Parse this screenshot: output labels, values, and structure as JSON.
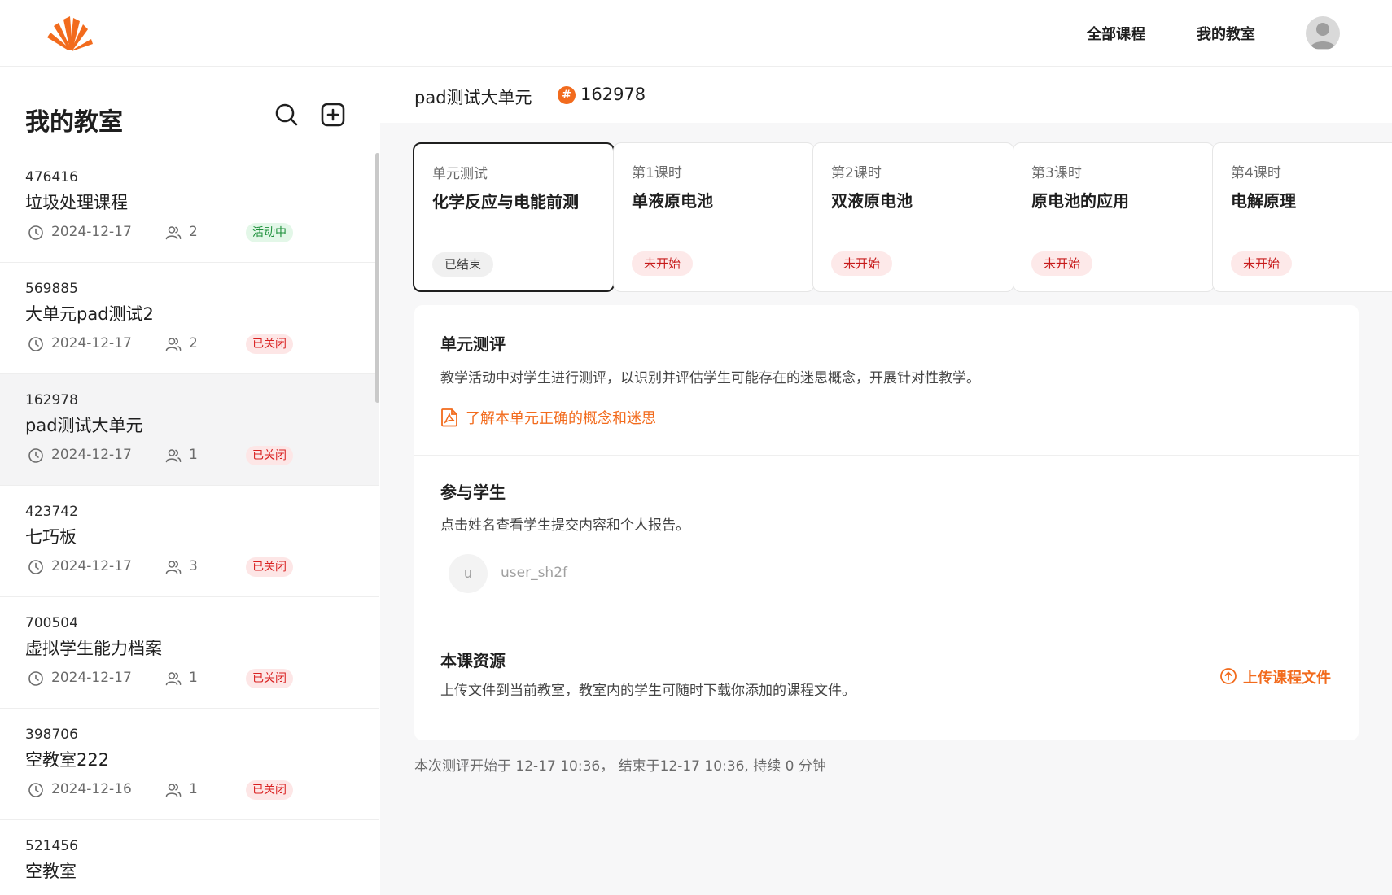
{
  "nav": {
    "all_courses": "全部课程",
    "my_classroom": "我的教室"
  },
  "sidebar": {
    "title": "我的教室",
    "classes": [
      {
        "id": "476416",
        "name": "垃圾处理课程",
        "date": "2024-12-17",
        "students": "2",
        "status": "活动中",
        "status_type": "active"
      },
      {
        "id": "569885",
        "name": "大单元pad测试2",
        "date": "2024-12-17",
        "students": "2",
        "status": "已关闭",
        "status_type": "closed"
      },
      {
        "id": "162978",
        "name": "pad测试大单元",
        "date": "2024-12-17",
        "students": "1",
        "status": "已关闭",
        "status_type": "closed"
      },
      {
        "id": "423742",
        "name": "七巧板",
        "date": "2024-12-17",
        "students": "3",
        "status": "已关闭",
        "status_type": "closed"
      },
      {
        "id": "700504",
        "name": "虚拟学生能力档案",
        "date": "2024-12-17",
        "students": "1",
        "status": "已关闭",
        "status_type": "closed"
      },
      {
        "id": "398706",
        "name": "空教室222",
        "date": "2024-12-16",
        "students": "1",
        "status": "已关闭",
        "status_type": "closed"
      },
      {
        "id": "521456",
        "name": "空教室",
        "date": "",
        "students": "",
        "status": "",
        "status_type": "closed"
      }
    ]
  },
  "main": {
    "title": "pad测试大单元",
    "hash_symbol": "#",
    "code": "162978",
    "lessons": [
      {
        "subtitle": "单元测试",
        "title": "化学反应与电能前测",
        "status": "已结束",
        "status_type": "ended"
      },
      {
        "subtitle": "第1课时",
        "title": "单液原电池",
        "status": "未开始",
        "status_type": "pending"
      },
      {
        "subtitle": "第2课时",
        "title": "双液原电池",
        "status": "未开始",
        "status_type": "pending"
      },
      {
        "subtitle": "第3课时",
        "title": "原电池的应用",
        "status": "未开始",
        "status_type": "pending"
      },
      {
        "subtitle": "第4课时",
        "title": "电解原理",
        "status": "未开始",
        "status_type": "pending"
      }
    ],
    "assessment": {
      "title": "单元测评",
      "desc": "教学活动中对学生进行测评，以识别并评估学生可能存在的迷思概念，开展针对性教学。",
      "link": "了解本单元正确的概念和迷思"
    },
    "students": {
      "title": "参与学生",
      "desc": "点击姓名查看学生提交内容和个人报告。",
      "list": [
        {
          "initial": "u",
          "name": "user_sh2f"
        }
      ]
    },
    "resources": {
      "title": "本课资源",
      "desc": "上传文件到当前教室，教室内的学生可随时下载你添加的课程文件。",
      "upload": "上传课程文件"
    },
    "footer": "本次测评开始于 12-17 10:36， 结束于12-17 10:36, 持续 0 分钟"
  },
  "colors": {
    "accent": "#f26b1d",
    "active_green": "#1d8f3a",
    "closed_red": "#d92020"
  }
}
